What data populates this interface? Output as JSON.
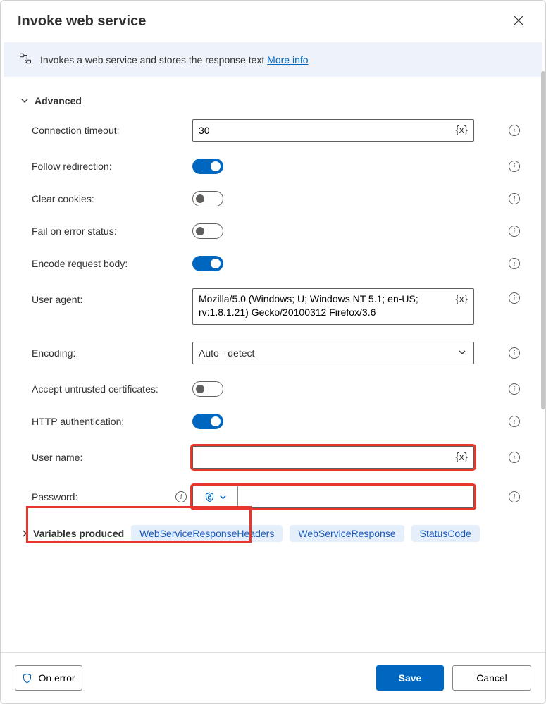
{
  "header": {
    "title": "Invoke web service"
  },
  "description": {
    "text": "Invokes a web service and stores the response text",
    "more_info": "More info"
  },
  "section": {
    "advanced": "Advanced"
  },
  "fields": {
    "connection_timeout": {
      "label": "Connection timeout:",
      "value": "30"
    },
    "follow_redirection": {
      "label": "Follow redirection:",
      "value": true
    },
    "clear_cookies": {
      "label": "Clear cookies:",
      "value": false
    },
    "fail_on_error": {
      "label": "Fail on error status:",
      "value": false
    },
    "encode_body": {
      "label": "Encode request body:",
      "value": true
    },
    "user_agent": {
      "label": "User agent:",
      "value": "Mozilla/5.0 (Windows; U; Windows NT 5.1; en-US; rv:1.8.1.21) Gecko/20100312 Firefox/3.6"
    },
    "encoding": {
      "label": "Encoding:",
      "value": "Auto - detect"
    },
    "accept_untrusted": {
      "label": "Accept untrusted certificates:",
      "value": false
    },
    "http_auth": {
      "label": "HTTP authentication:",
      "value": true
    },
    "user_name": {
      "label": "User name:",
      "value": ""
    },
    "password": {
      "label": "Password:",
      "value": ""
    }
  },
  "var_badge": "{x}",
  "variables_produced": {
    "label": "Variables produced",
    "chips": [
      "WebServiceResponseHeaders",
      "WebServiceResponse",
      "StatusCode"
    ]
  },
  "footer": {
    "on_error": "On error",
    "save": "Save",
    "cancel": "Cancel"
  }
}
